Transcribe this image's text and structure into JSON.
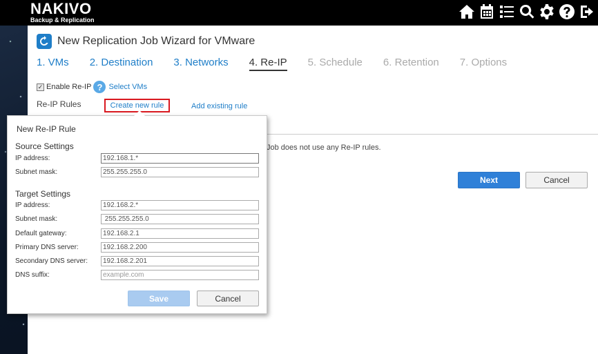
{
  "app": {
    "logo_line1": "NAKIVO",
    "logo_line2": "Backup & Replication",
    "top_icons": [
      "home-icon",
      "calendar-icon",
      "list-icon",
      "search-icon",
      "gear-icon",
      "help-icon",
      "logout-icon"
    ]
  },
  "wizard": {
    "title": "New Replication Job Wizard for VMware",
    "steps": [
      {
        "label": "1. VMs",
        "state": "link"
      },
      {
        "label": "2. Destination",
        "state": "link"
      },
      {
        "label": "3. Networks",
        "state": "link"
      },
      {
        "label": "4. Re-IP",
        "state": "current"
      },
      {
        "label": "5. Schedule",
        "state": "disabled"
      },
      {
        "label": "6. Retention",
        "state": "disabled"
      },
      {
        "label": "7. Options",
        "state": "disabled"
      }
    ],
    "enable_reip_label": "Enable Re-IP",
    "enable_reip_checked": true,
    "help_glyph": "?",
    "select_vms_label": "Select VMs",
    "reip_rules_label": "Re-IP Rules",
    "create_rule_label": "Create new rule",
    "add_existing_label": "Add existing rule",
    "empty_note": "Job does not use any Re-IP rules.",
    "next_label": "Next",
    "cancel_label": "Cancel"
  },
  "popup": {
    "title": "New Re-IP Rule",
    "source_heading": "Source Settings",
    "target_heading": "Target Settings",
    "source_fields": [
      {
        "label": "IP address:",
        "value": "192.168.1.*"
      },
      {
        "label": "Subnet mask:",
        "value": "255.255.255.0"
      }
    ],
    "target_fields": [
      {
        "label": "IP address:",
        "value": "192.168.2.*"
      },
      {
        "label": "Subnet mask:",
        "value": " 255.255.255.0"
      },
      {
        "label": "Default gateway:",
        "value": "192.168.2.1"
      },
      {
        "label": "Primary DNS server:",
        "value": "192.168.2.200"
      },
      {
        "label": "Secondary DNS server:",
        "value": "192.168.2.201"
      },
      {
        "label": "DNS suffix:",
        "placeholder": "example.com"
      }
    ],
    "save_label": "Save",
    "cancel_label": "Cancel"
  },
  "colors": {
    "accent": "#1f7ec8",
    "primary_button": "#2f80d8",
    "disabled_button": "#a9cbf0",
    "highlight_border": "#d9181f"
  }
}
